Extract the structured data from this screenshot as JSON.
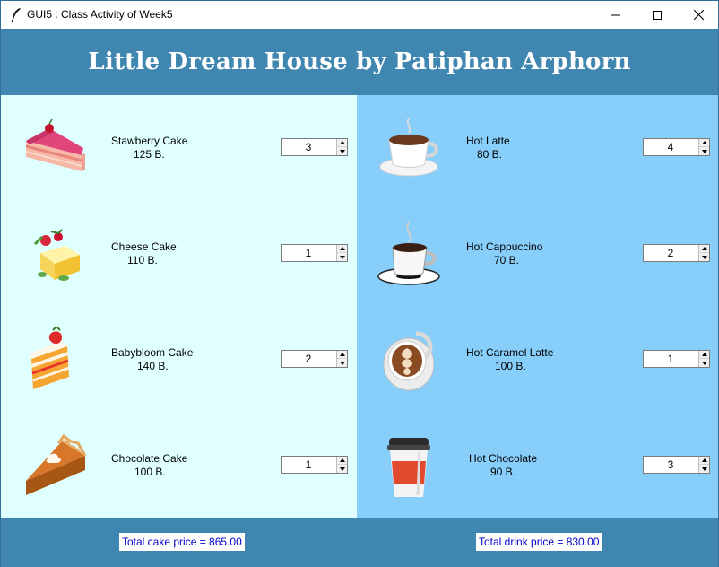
{
  "window": {
    "title": "GUI5 : Class Activity of Week5"
  },
  "header": {
    "title": "Little Dream House by Patiphan Arphorn"
  },
  "cakes": [
    {
      "name": "Stawberry Cake",
      "price": "125 B.",
      "quantity": "3",
      "icon": "strawberry-cake-slice-icon"
    },
    {
      "name": "Cheese Cake",
      "price": "110 B.",
      "quantity": "1",
      "icon": "cheese-cake-icon"
    },
    {
      "name": "Babybloom Cake",
      "price": "140 B.",
      "quantity": "2",
      "icon": "strawberry-shortcake-icon"
    },
    {
      "name": "Chocolate Cake",
      "price": "100 B.",
      "quantity": "1",
      "icon": "pie-slice-icon"
    }
  ],
  "drinks": [
    {
      "name": "Hot Latte",
      "price": "80 B.",
      "quantity": "4",
      "icon": "coffee-cup-icon"
    },
    {
      "name": "Hot Cappuccino",
      "price": "70 B.",
      "quantity": "2",
      "icon": "steaming-cup-icon"
    },
    {
      "name": "Hot Caramel Latte",
      "price": "100 B.",
      "quantity": "1",
      "icon": "latte-art-cup-icon"
    },
    {
      "name": "Hot Chocolate",
      "price": "90 B.",
      "quantity": "3",
      "icon": "takeaway-cup-icon"
    }
  ],
  "totals": {
    "cake": "Total cake price = 865.00",
    "drink": "Total drink price = 830.00"
  },
  "colors": {
    "header_bg": "#3f86b0",
    "left_panel_bg": "#e0ffff",
    "right_panel_bg": "#87cefa",
    "total_text": "#0000cc"
  }
}
